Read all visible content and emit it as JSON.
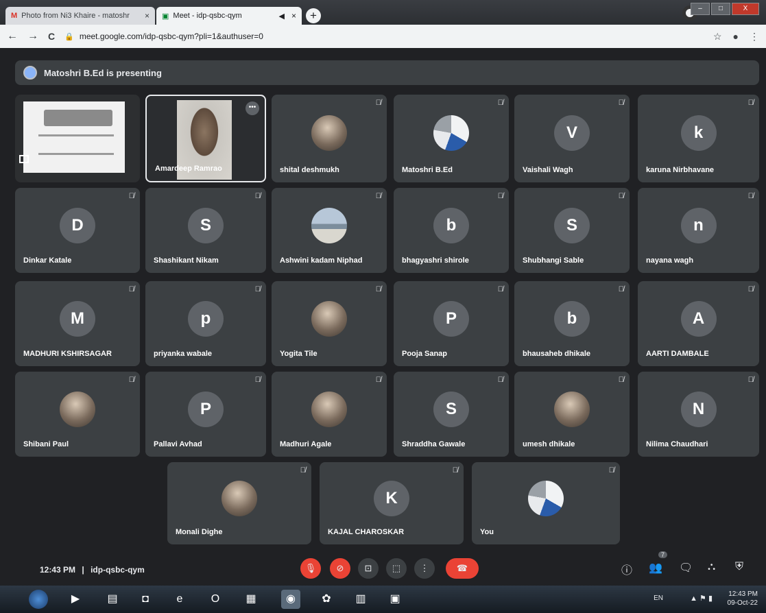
{
  "browser": {
    "tabs": [
      {
        "label": "Photo from Ni3 Khaire - matoshr",
        "close": "×"
      },
      {
        "label": "Meet - idp-qsbc-qym",
        "close": "×"
      }
    ],
    "new_tab": "+",
    "url": "meet.google.com/idp-qsbc-qym?pli=1&authuser=0",
    "nav": {
      "back": "←",
      "forward": "→",
      "reload": "C"
    },
    "window_controls": {
      "minimize": "–",
      "maximize": "□",
      "close": "X"
    }
  },
  "meet": {
    "presenting_text": "Matoshri B.Ed is presenting",
    "tiles": [
      {
        "kind": "present",
        "name": ""
      },
      {
        "kind": "video",
        "name": "Amardeep Ramrao"
      },
      {
        "kind": "avatar",
        "style": "photo",
        "name": "shital deshmukh",
        "initial": ""
      },
      {
        "kind": "avatar",
        "style": "logo",
        "name": "Matoshri B.Ed",
        "initial": ""
      },
      {
        "kind": "avatar",
        "style": "letter",
        "name": "Vaishali Wagh",
        "initial": "V",
        "color": "#5f6368"
      },
      {
        "kind": "avatar",
        "style": "letter",
        "name": "karuna Nirbhavane",
        "initial": "k",
        "color": "#5f6368"
      },
      {
        "kind": "avatar",
        "style": "letter",
        "name": "Dinkar Katale",
        "initial": "D",
        "color": "#5f6368"
      },
      {
        "kind": "avatar",
        "style": "letter",
        "name": "Shashikant Nikam",
        "initial": "S",
        "color": "#5f6368"
      },
      {
        "kind": "avatar",
        "style": "scenic",
        "name": "Ashwini kadam Niphad",
        "initial": ""
      },
      {
        "kind": "avatar",
        "style": "letter",
        "name": "bhagyashri shirole",
        "initial": "b",
        "color": "#5f6368"
      },
      {
        "kind": "avatar",
        "style": "letter",
        "name": "Shubhangi Sable",
        "initial": "S",
        "color": "#5f6368"
      },
      {
        "kind": "avatar",
        "style": "letter",
        "name": "nayana wagh",
        "initial": "n",
        "color": "#5f6368"
      },
      {
        "kind": "avatar",
        "style": "letter",
        "name": "MADHURI KSHIRSAGAR",
        "initial": "M",
        "color": "#5f6368"
      },
      {
        "kind": "avatar",
        "style": "letter",
        "name": "priyanka wabale",
        "initial": "p",
        "color": "#5f6368"
      },
      {
        "kind": "avatar",
        "style": "photo",
        "name": "Yogita Tile",
        "initial": ""
      },
      {
        "kind": "avatar",
        "style": "letter",
        "name": "Pooja Sanap",
        "initial": "P",
        "color": "#5f6368"
      },
      {
        "kind": "avatar",
        "style": "letter",
        "name": "bhausaheb dhikale",
        "initial": "b",
        "color": "#5f6368"
      },
      {
        "kind": "avatar",
        "style": "letter",
        "name": "AARTI DAMBALE",
        "initial": "A",
        "color": "#5f6368"
      },
      {
        "kind": "avatar",
        "style": "photo",
        "name": "Shibani Paul",
        "initial": ""
      },
      {
        "kind": "avatar",
        "style": "letter",
        "name": "Pallavi Avhad",
        "initial": "P",
        "color": "#5f6368"
      },
      {
        "kind": "avatar",
        "style": "photo",
        "name": "Madhuri Agale",
        "initial": ""
      },
      {
        "kind": "avatar",
        "style": "letter",
        "name": "Shraddha Gawale",
        "initial": "S",
        "color": "#5f6368"
      },
      {
        "kind": "avatar",
        "style": "photo",
        "name": "umesh dhikale",
        "initial": ""
      },
      {
        "kind": "avatar",
        "style": "letter",
        "name": "Nilima Chaudhari",
        "initial": "N",
        "color": "#5f6368"
      },
      {
        "kind": "avatar",
        "style": "photo",
        "name": "Monali Dighe",
        "initial": ""
      },
      {
        "kind": "avatar",
        "style": "letter",
        "name": "KAJAL CHAROSKAR",
        "initial": "K",
        "color": "#5f6368"
      },
      {
        "kind": "avatar",
        "style": "logo",
        "name": "You",
        "initial": ""
      }
    ],
    "bottom": {
      "time": "12:43 PM",
      "separator": "|",
      "meeting_code": "idp-qsbc-qym",
      "participant_count": "7"
    }
  },
  "taskbar": {
    "lang": "EN",
    "time": "12:43 PM",
    "date": "09-Oct-22"
  }
}
